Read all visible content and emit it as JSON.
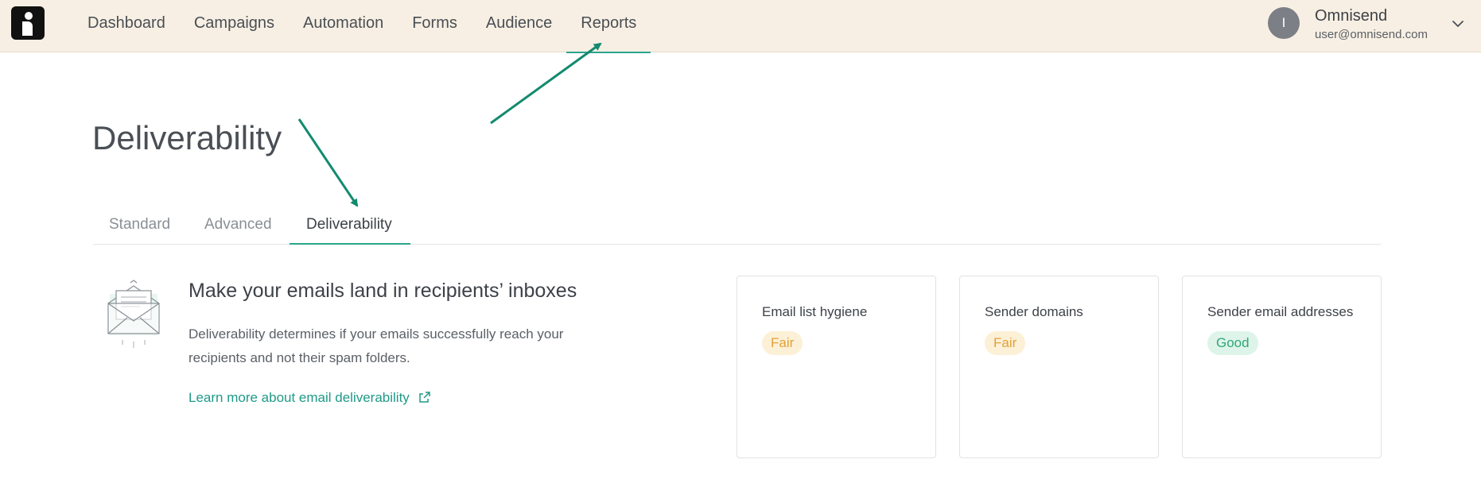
{
  "nav": {
    "items": [
      {
        "label": "Dashboard",
        "active": false
      },
      {
        "label": "Campaigns",
        "active": false
      },
      {
        "label": "Automation",
        "active": false
      },
      {
        "label": "Forms",
        "active": false
      },
      {
        "label": "Audience",
        "active": false
      },
      {
        "label": "Reports",
        "active": true
      }
    ]
  },
  "account": {
    "avatar_initial": "I",
    "name": "Omnisend",
    "email": "user@omnisend.com"
  },
  "page": {
    "title": "Deliverability"
  },
  "tabs": [
    {
      "label": "Standard",
      "active": false
    },
    {
      "label": "Advanced",
      "active": false
    },
    {
      "label": "Deliverability",
      "active": true
    }
  ],
  "intro": {
    "title": "Make your emails land in recipients’ inboxes",
    "description": "Deliverability determines if your emails successfully reach your recipients and not their spam folders.",
    "link_label": "Learn more about email deliverability"
  },
  "cards": [
    {
      "title": "Email list hygiene",
      "status": "Fair"
    },
    {
      "title": "Sender domains",
      "status": "Fair"
    },
    {
      "title": "Sender email addresses",
      "status": "Good"
    }
  ],
  "colors": {
    "accent": "#2aa58c",
    "topbar_bg": "#f7efe3",
    "fair_text": "#e2a13b",
    "fair_bg": "#fcf0d6",
    "good_text": "#2fa878",
    "good_bg": "#def4ea",
    "annotation_arrow": "#138a6f"
  }
}
